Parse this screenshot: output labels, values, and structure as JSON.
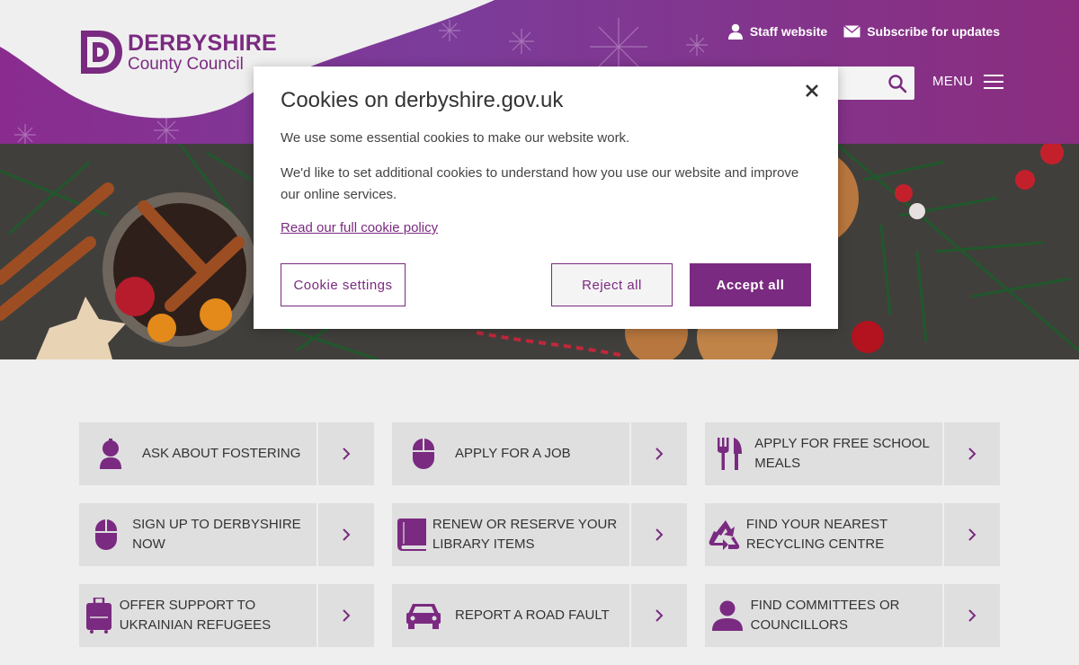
{
  "brand": {
    "name_line1": "DERBYSHIRE",
    "name_line2": "County Council",
    "color": "#7a2a80"
  },
  "header": {
    "links": [
      {
        "label": "Staff website",
        "icon": "person-icon"
      },
      {
        "label": "Subscribe for updates",
        "icon": "envelope-icon"
      }
    ],
    "search": {
      "icon": "search-icon"
    },
    "menu_label": "MENU"
  },
  "cookie_dialog": {
    "title": "Cookies on derbyshire.gov.uk",
    "text1": "We use some essential cookies to make our website work.",
    "text2": "We'd like to set additional cookies to understand how you use our website and improve our online services.",
    "policy_link": "Read our full cookie policy",
    "buttons": {
      "settings": "Cookie settings",
      "reject": "Reject all",
      "accept": "Accept all"
    }
  },
  "tiles": [
    {
      "label": "ASK ABOUT FOSTERING",
      "icon": "child-icon"
    },
    {
      "label": "APPLY FOR A JOB",
      "icon": "mouse-icon"
    },
    {
      "label": "APPLY FOR FREE SCHOOL MEALS",
      "icon": "cutlery-icon"
    },
    {
      "label": "SIGN UP TO DERBYSHIRE NOW",
      "icon": "mouse-icon"
    },
    {
      "label": "RENEW OR RESERVE YOUR LIBRARY ITEMS",
      "icon": "book-icon"
    },
    {
      "label": "FIND YOUR NEAREST RECYCLING CENTRE",
      "icon": "recycle-icon"
    },
    {
      "label": "OFFER SUPPORT TO UKRAINIAN REFUGEES",
      "icon": "suitcase-icon"
    },
    {
      "label": "REPORT A ROAD FAULT",
      "icon": "car-icon"
    },
    {
      "label": "FIND COMMITTEES OR COUNCILLORS",
      "icon": "person-icon"
    }
  ]
}
